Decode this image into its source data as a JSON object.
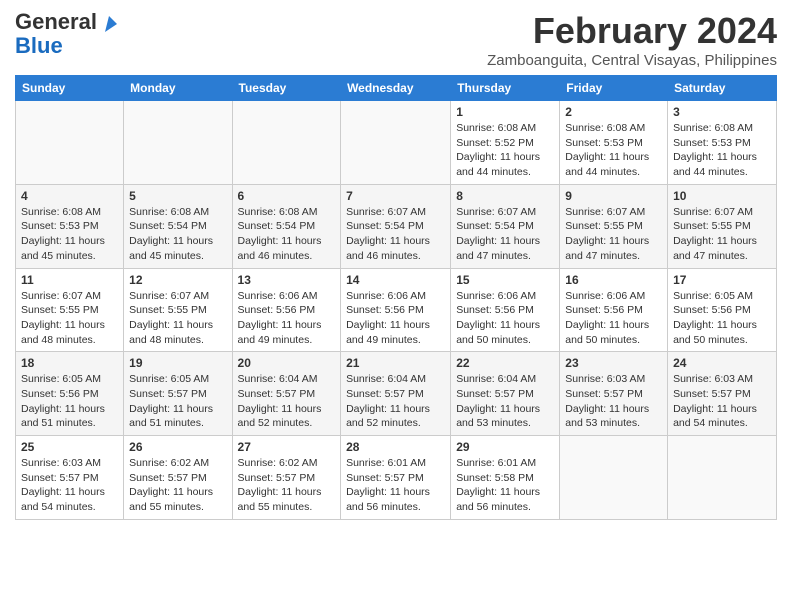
{
  "header": {
    "logo_general": "General",
    "logo_blue": "Blue",
    "month_year": "February 2024",
    "location": "Zamboanguita, Central Visayas, Philippines"
  },
  "days_of_week": [
    "Sunday",
    "Monday",
    "Tuesday",
    "Wednesday",
    "Thursday",
    "Friday",
    "Saturday"
  ],
  "weeks": [
    [
      {
        "num": "",
        "info": ""
      },
      {
        "num": "",
        "info": ""
      },
      {
        "num": "",
        "info": ""
      },
      {
        "num": "",
        "info": ""
      },
      {
        "num": "1",
        "info": "Sunrise: 6:08 AM\nSunset: 5:52 PM\nDaylight: 11 hours and 44 minutes."
      },
      {
        "num": "2",
        "info": "Sunrise: 6:08 AM\nSunset: 5:53 PM\nDaylight: 11 hours and 44 minutes."
      },
      {
        "num": "3",
        "info": "Sunrise: 6:08 AM\nSunset: 5:53 PM\nDaylight: 11 hours and 44 minutes."
      }
    ],
    [
      {
        "num": "4",
        "info": "Sunrise: 6:08 AM\nSunset: 5:53 PM\nDaylight: 11 hours and 45 minutes."
      },
      {
        "num": "5",
        "info": "Sunrise: 6:08 AM\nSunset: 5:54 PM\nDaylight: 11 hours and 45 minutes."
      },
      {
        "num": "6",
        "info": "Sunrise: 6:08 AM\nSunset: 5:54 PM\nDaylight: 11 hours and 46 minutes."
      },
      {
        "num": "7",
        "info": "Sunrise: 6:07 AM\nSunset: 5:54 PM\nDaylight: 11 hours and 46 minutes."
      },
      {
        "num": "8",
        "info": "Sunrise: 6:07 AM\nSunset: 5:54 PM\nDaylight: 11 hours and 47 minutes."
      },
      {
        "num": "9",
        "info": "Sunrise: 6:07 AM\nSunset: 5:55 PM\nDaylight: 11 hours and 47 minutes."
      },
      {
        "num": "10",
        "info": "Sunrise: 6:07 AM\nSunset: 5:55 PM\nDaylight: 11 hours and 47 minutes."
      }
    ],
    [
      {
        "num": "11",
        "info": "Sunrise: 6:07 AM\nSunset: 5:55 PM\nDaylight: 11 hours and 48 minutes."
      },
      {
        "num": "12",
        "info": "Sunrise: 6:07 AM\nSunset: 5:55 PM\nDaylight: 11 hours and 48 minutes."
      },
      {
        "num": "13",
        "info": "Sunrise: 6:06 AM\nSunset: 5:56 PM\nDaylight: 11 hours and 49 minutes."
      },
      {
        "num": "14",
        "info": "Sunrise: 6:06 AM\nSunset: 5:56 PM\nDaylight: 11 hours and 49 minutes."
      },
      {
        "num": "15",
        "info": "Sunrise: 6:06 AM\nSunset: 5:56 PM\nDaylight: 11 hours and 50 minutes."
      },
      {
        "num": "16",
        "info": "Sunrise: 6:06 AM\nSunset: 5:56 PM\nDaylight: 11 hours and 50 minutes."
      },
      {
        "num": "17",
        "info": "Sunrise: 6:05 AM\nSunset: 5:56 PM\nDaylight: 11 hours and 50 minutes."
      }
    ],
    [
      {
        "num": "18",
        "info": "Sunrise: 6:05 AM\nSunset: 5:56 PM\nDaylight: 11 hours and 51 minutes."
      },
      {
        "num": "19",
        "info": "Sunrise: 6:05 AM\nSunset: 5:57 PM\nDaylight: 11 hours and 51 minutes."
      },
      {
        "num": "20",
        "info": "Sunrise: 6:04 AM\nSunset: 5:57 PM\nDaylight: 11 hours and 52 minutes."
      },
      {
        "num": "21",
        "info": "Sunrise: 6:04 AM\nSunset: 5:57 PM\nDaylight: 11 hours and 52 minutes."
      },
      {
        "num": "22",
        "info": "Sunrise: 6:04 AM\nSunset: 5:57 PM\nDaylight: 11 hours and 53 minutes."
      },
      {
        "num": "23",
        "info": "Sunrise: 6:03 AM\nSunset: 5:57 PM\nDaylight: 11 hours and 53 minutes."
      },
      {
        "num": "24",
        "info": "Sunrise: 6:03 AM\nSunset: 5:57 PM\nDaylight: 11 hours and 54 minutes."
      }
    ],
    [
      {
        "num": "25",
        "info": "Sunrise: 6:03 AM\nSunset: 5:57 PM\nDaylight: 11 hours and 54 minutes."
      },
      {
        "num": "26",
        "info": "Sunrise: 6:02 AM\nSunset: 5:57 PM\nDaylight: 11 hours and 55 minutes."
      },
      {
        "num": "27",
        "info": "Sunrise: 6:02 AM\nSunset: 5:57 PM\nDaylight: 11 hours and 55 minutes."
      },
      {
        "num": "28",
        "info": "Sunrise: 6:01 AM\nSunset: 5:57 PM\nDaylight: 11 hours and 56 minutes."
      },
      {
        "num": "29",
        "info": "Sunrise: 6:01 AM\nSunset: 5:58 PM\nDaylight: 11 hours and 56 minutes."
      },
      {
        "num": "",
        "info": ""
      },
      {
        "num": "",
        "info": ""
      }
    ]
  ]
}
